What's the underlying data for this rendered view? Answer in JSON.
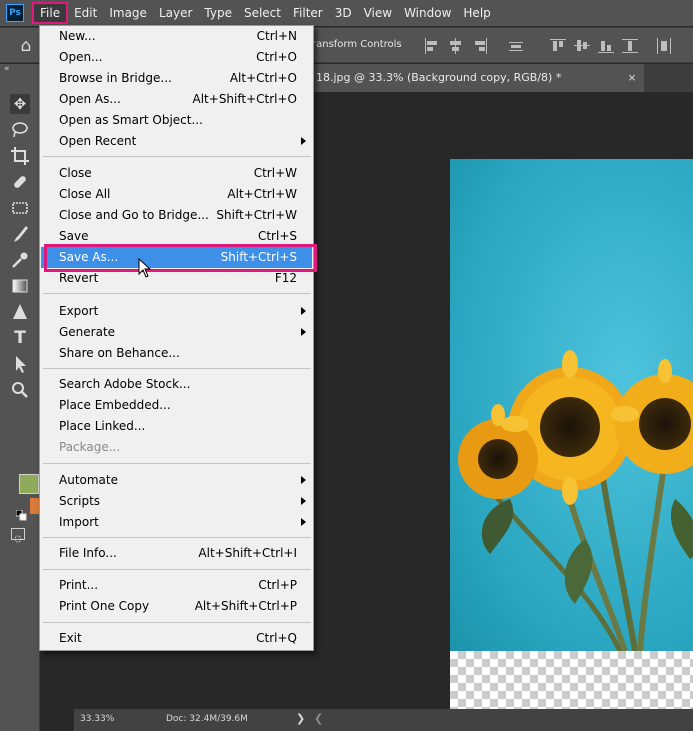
{
  "menubar": {
    "logo_text": "Ps",
    "items": [
      "File",
      "Edit",
      "Image",
      "Layer",
      "Type",
      "Select",
      "Filter",
      "3D",
      "View",
      "Window",
      "Help"
    ]
  },
  "optionsbar": {
    "transform_label": "ransform Controls",
    "home_icon": "home-icon"
  },
  "document": {
    "tab_title": "18.jpg @ 33.3% (Background copy, RGB/8) *",
    "close_glyph": "×"
  },
  "toolbar": {
    "collapse_glyph": "«",
    "tools": [
      "move",
      "lasso",
      "crop",
      "healing-brush",
      "stamp",
      "brush",
      "quick-selection",
      "gradient",
      "sharpen",
      "type",
      "path-selection",
      "zoom"
    ]
  },
  "colors": {
    "foreground": "#8eaa5a",
    "background": "#d87a3a",
    "highlight_blue": "#3d8fe8",
    "annotation_pink": "#e0197d"
  },
  "statusbar": {
    "zoom": "33.33%",
    "doc_size": "Doc: 32.4M/39.6M",
    "arrow_glyph": "❯",
    "scroll_glyph": "❮"
  },
  "file_menu": {
    "items": [
      {
        "label": "New...",
        "shortcut": "Ctrl+N"
      },
      {
        "label": "Open...",
        "shortcut": "Ctrl+O"
      },
      {
        "label": "Browse in Bridge...",
        "shortcut": "Alt+Ctrl+O"
      },
      {
        "label": "Open As...",
        "shortcut": "Alt+Shift+Ctrl+O"
      },
      {
        "label": "Open as Smart Object...",
        "shortcut": ""
      },
      {
        "label": "Open Recent",
        "shortcut": "",
        "submenu": true
      },
      {
        "label": "Close",
        "shortcut": "Ctrl+W"
      },
      {
        "label": "Close All",
        "shortcut": "Alt+Ctrl+W"
      },
      {
        "label": "Close and Go to Bridge...",
        "shortcut": "Shift+Ctrl+W"
      },
      {
        "label": "Save",
        "shortcut": "Ctrl+S"
      },
      {
        "label": "Save As...",
        "shortcut": "Shift+Ctrl+S",
        "highlighted": true
      },
      {
        "label": "Revert",
        "shortcut": "F12"
      },
      {
        "label": "Export",
        "shortcut": "",
        "submenu": true
      },
      {
        "label": "Generate",
        "shortcut": "",
        "submenu": true
      },
      {
        "label": "Share on Behance...",
        "shortcut": ""
      },
      {
        "label": "Search Adobe Stock...",
        "shortcut": ""
      },
      {
        "label": "Place Embedded...",
        "shortcut": ""
      },
      {
        "label": "Place Linked...",
        "shortcut": ""
      },
      {
        "label": "Package...",
        "shortcut": "",
        "disabled": true
      },
      {
        "label": "Automate",
        "shortcut": "",
        "submenu": true
      },
      {
        "label": "Scripts",
        "shortcut": "",
        "submenu": true
      },
      {
        "label": "Import",
        "shortcut": "",
        "submenu": true
      },
      {
        "label": "File Info...",
        "shortcut": "Alt+Shift+Ctrl+I"
      },
      {
        "label": "Print...",
        "shortcut": "Ctrl+P"
      },
      {
        "label": "Print One Copy",
        "shortcut": "Alt+Shift+Ctrl+P"
      },
      {
        "label": "Exit",
        "shortcut": "Ctrl+Q"
      }
    ]
  }
}
